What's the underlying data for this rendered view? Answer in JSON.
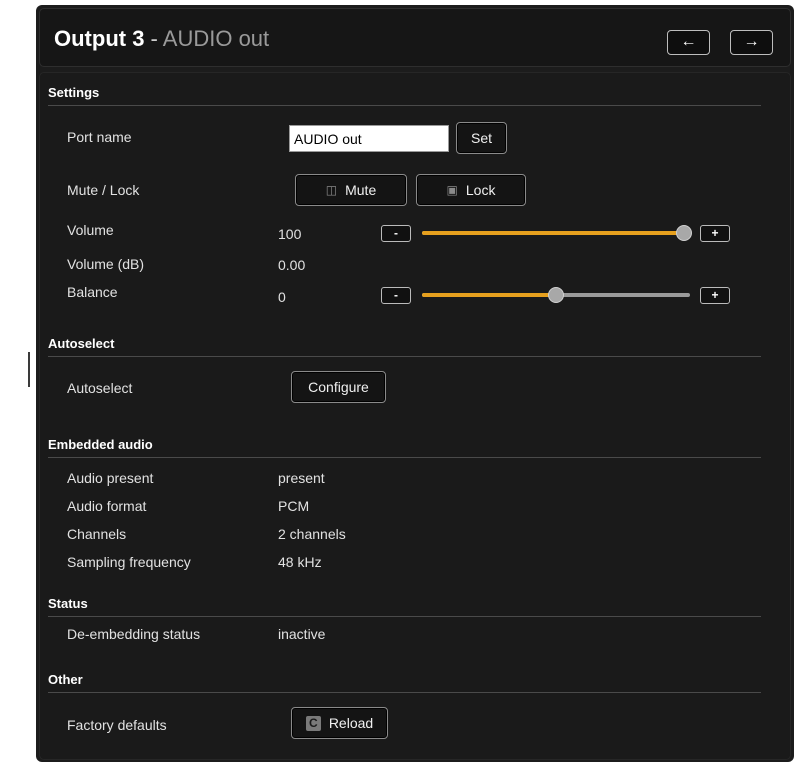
{
  "header": {
    "title_bold": "Output 3",
    "title_sep": " - ",
    "title_sub": "AUDIO out",
    "prev_label": "←",
    "next_label": "→"
  },
  "sections": {
    "settings": "Settings",
    "autoselect": "Autoselect",
    "embedded": "Embedded audio",
    "status": "Status",
    "other": "Other"
  },
  "settings": {
    "port_name_label": "Port name",
    "port_name_value": "AUDIO out",
    "set_label": "Set",
    "mute_lock_label": "Mute / Lock",
    "mute_label": "Mute",
    "lock_label": "Lock",
    "volume_label": "Volume",
    "volume_value": "100",
    "volume_db_label": "Volume (dB)",
    "volume_db_value": "0.00",
    "balance_label": "Balance",
    "balance_value": "0",
    "minus": "-",
    "plus": "+",
    "volume_fraction": 1.0,
    "balance_fraction": 0.5,
    "slider_color": "#e6a01e"
  },
  "autoselect": {
    "label": "Autoselect",
    "button": "Configure"
  },
  "embedded": {
    "audio_present_label": "Audio present",
    "audio_present_value": "present",
    "audio_format_label": "Audio format",
    "audio_format_value": "PCM",
    "channels_label": "Channels",
    "channels_value": "2 channels",
    "sampling_label": "Sampling frequency",
    "sampling_value": "48 kHz"
  },
  "status": {
    "deembed_label": "De-embedding status",
    "deembed_value": "inactive"
  },
  "other": {
    "factory_label": "Factory defaults",
    "reload_label": "Reload"
  },
  "icons": {
    "mute": "speaker-muted-icon",
    "lock": "lock-icon",
    "reload": "reload-icon",
    "prev": "arrow-left-icon",
    "next": "arrow-right-icon"
  }
}
